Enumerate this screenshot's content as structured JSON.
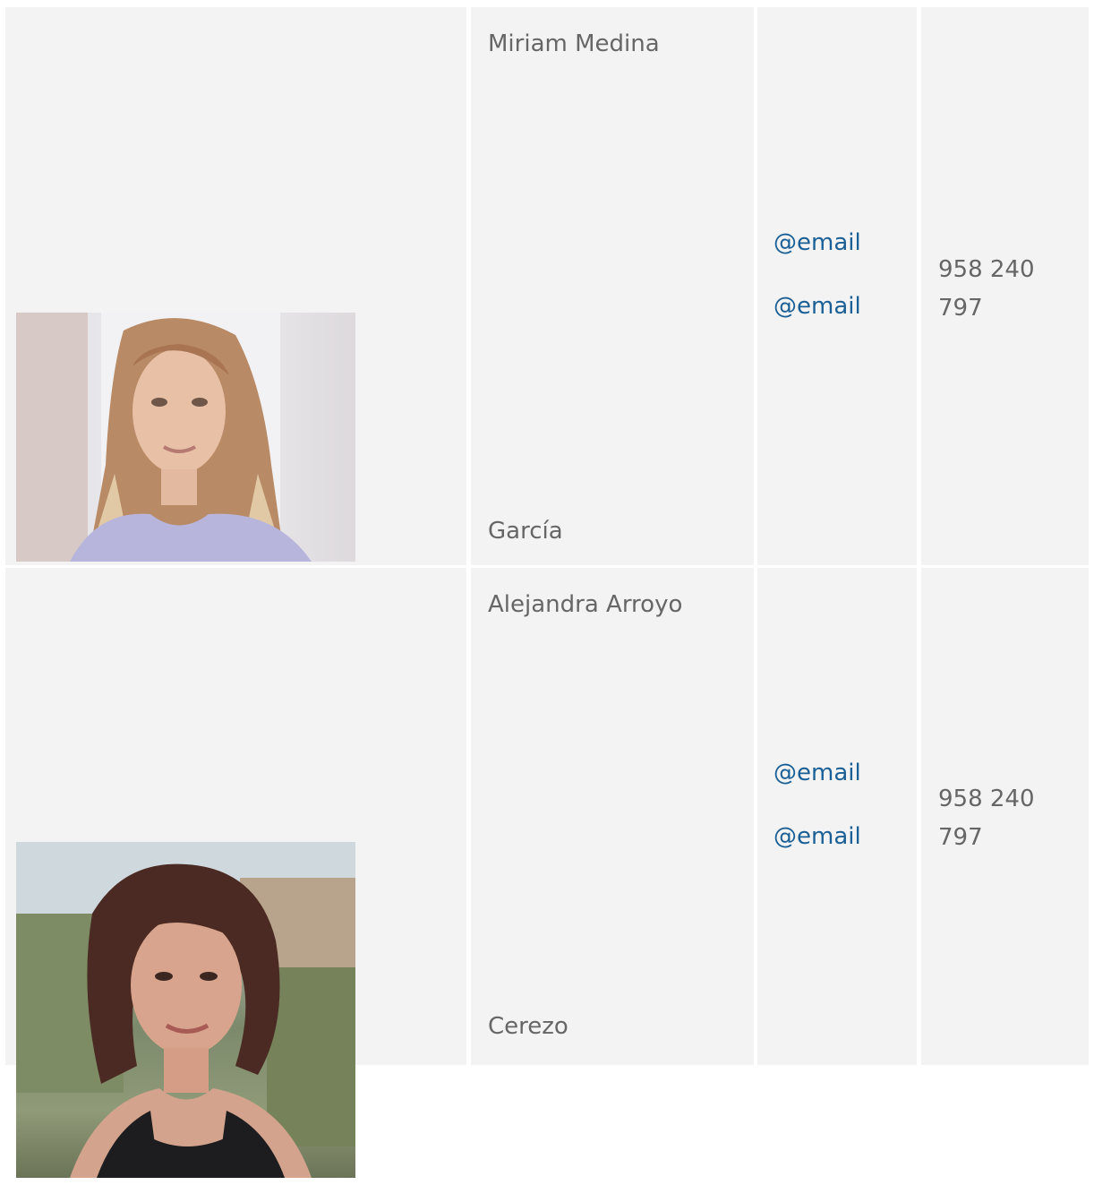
{
  "contacts": [
    {
      "photo": "portrait-photo",
      "first": "Miriam Medina",
      "last": "García",
      "email1": "@email",
      "email2": "@email",
      "phone": "958 240 797"
    },
    {
      "photo": "portrait-photo",
      "first": "Alejandra Arroyo",
      "last": "Cerezo",
      "email1": "@email",
      "email2": "@email",
      "phone": "958 240 797"
    }
  ],
  "colors": {
    "cell_bg": "#f3f3f3",
    "text": "#666666",
    "link": "#1a5f96"
  }
}
